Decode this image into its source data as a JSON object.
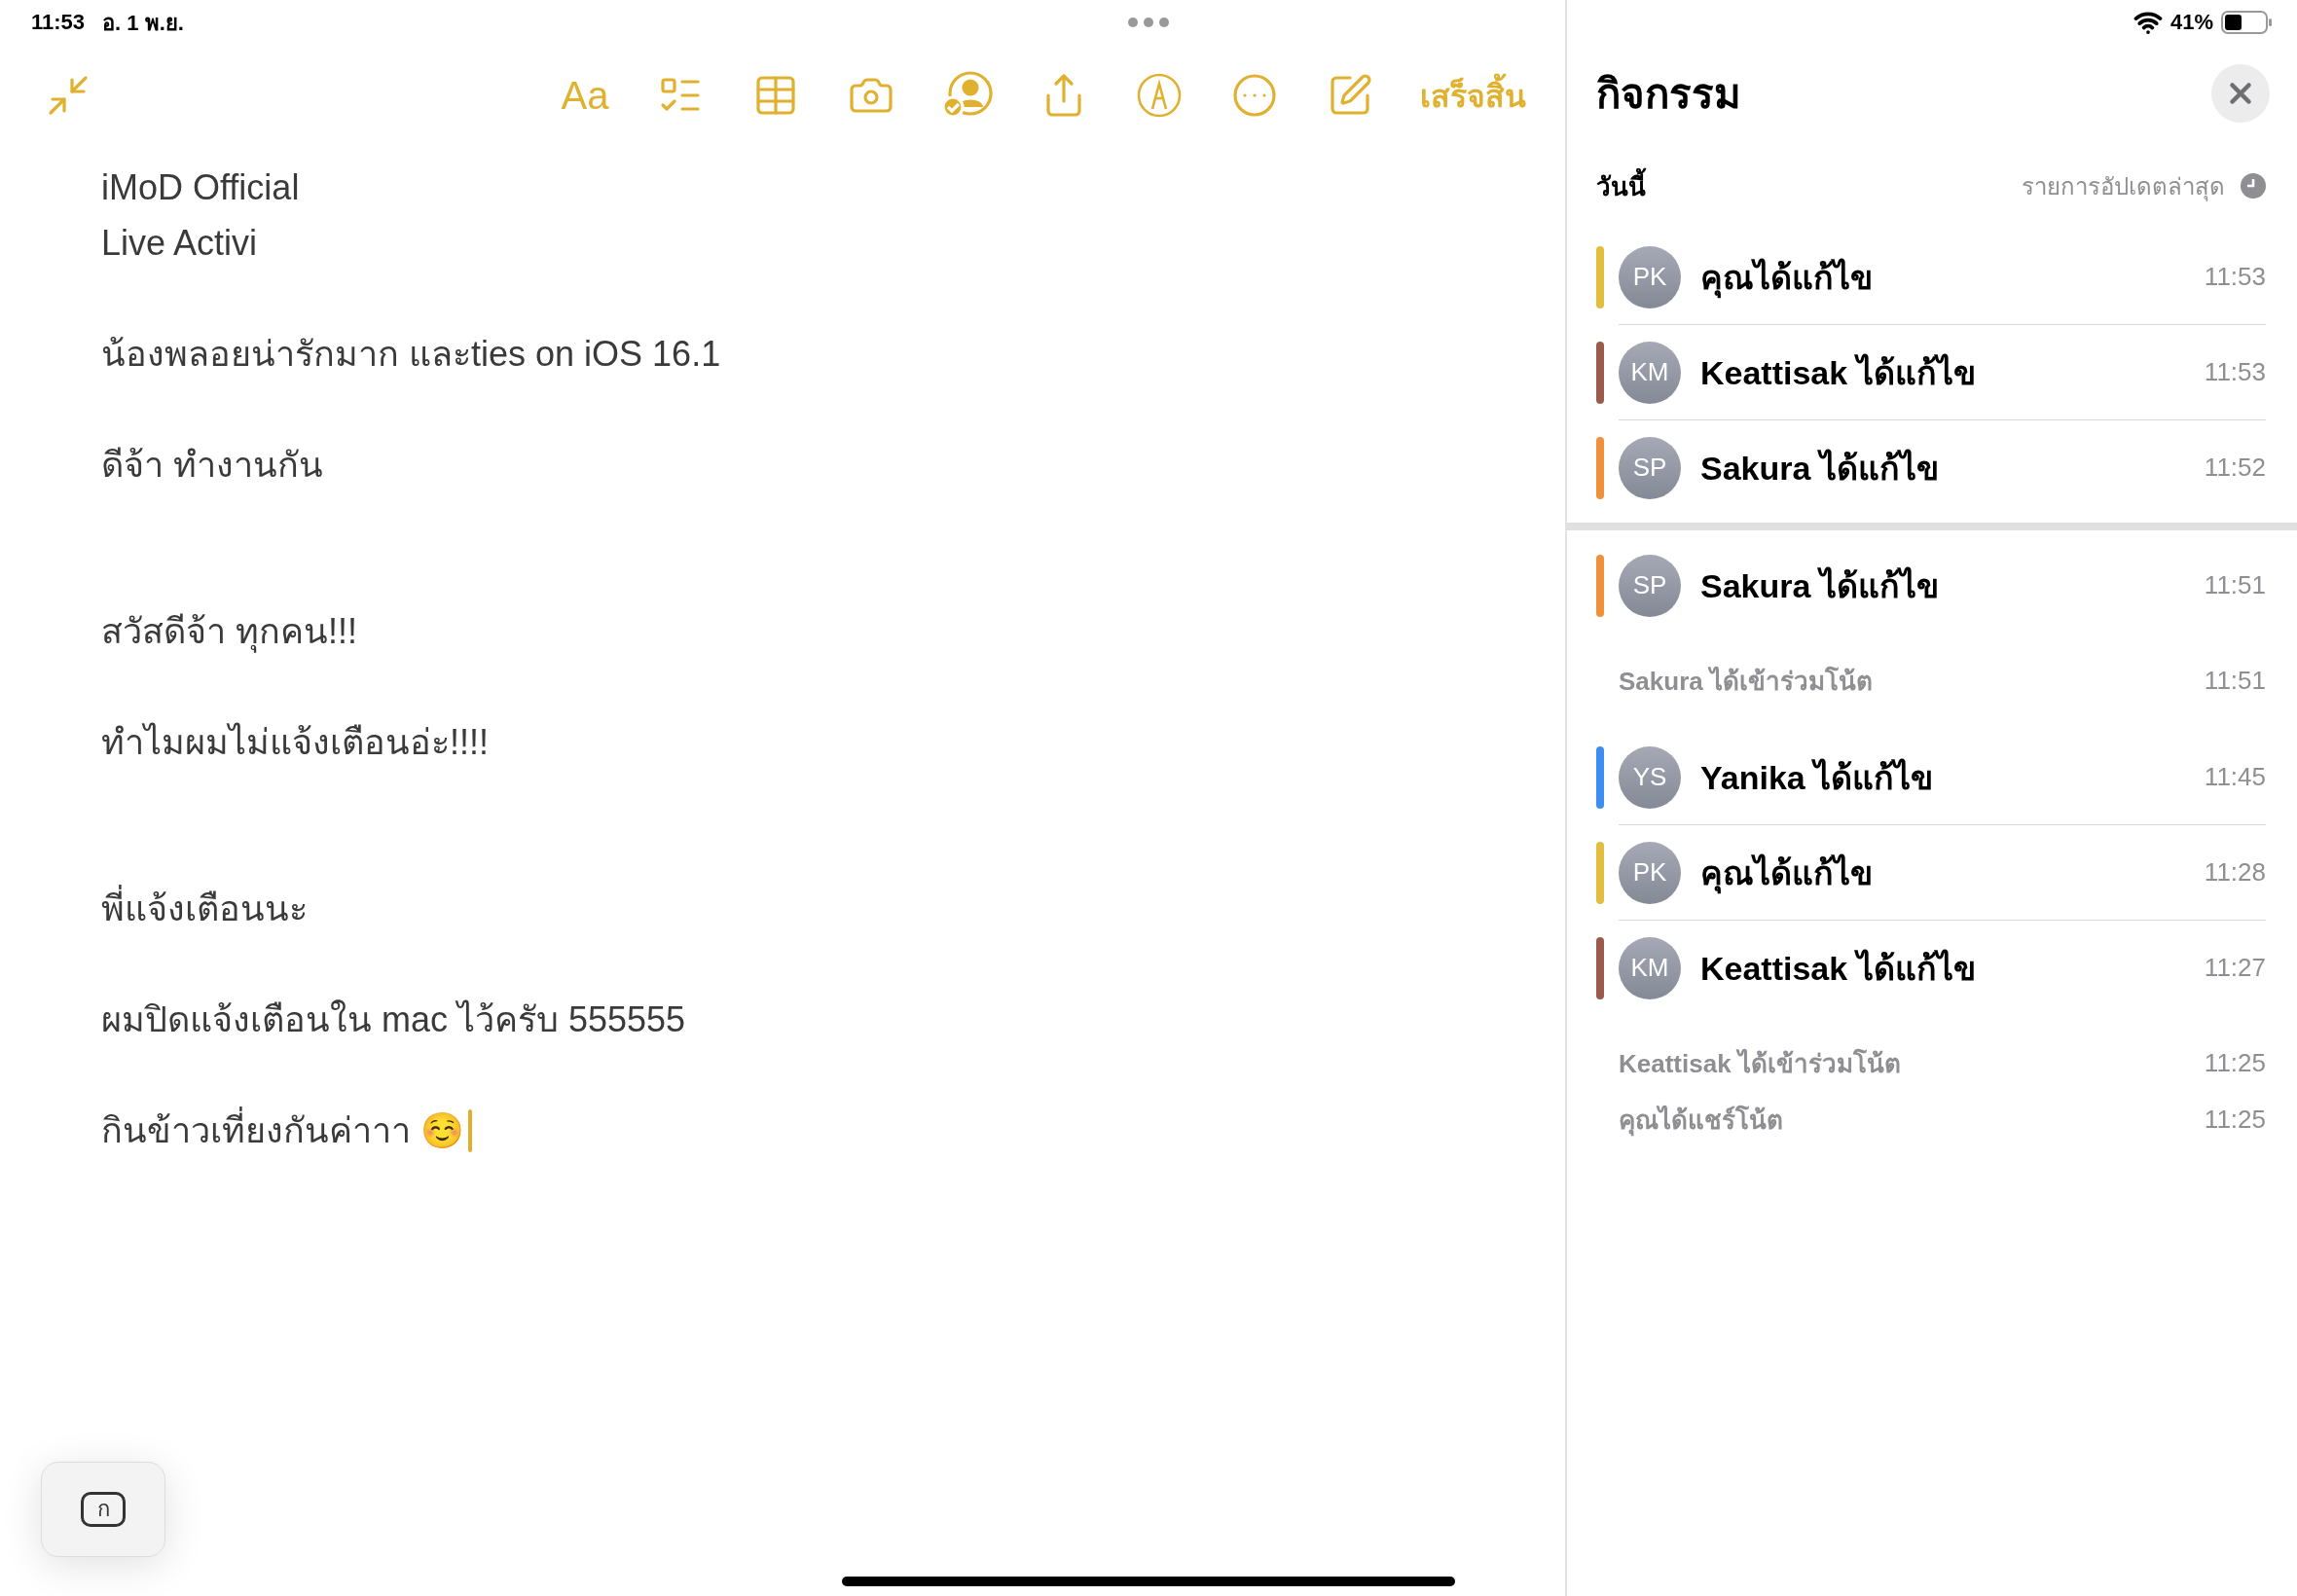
{
  "status_bar": {
    "time": "11:53",
    "date": "อ. 1 พ.ย.",
    "battery": "41%"
  },
  "toolbar": {
    "format_label": "Aa",
    "done_label": "เสร็จสิ้น"
  },
  "note": {
    "text": "iMoD Official\nLive Activi\n\nน้องพลอยน่ารักมาก และties on iOS 16.1\n\nดีจ้า ทำงานกัน\n\n\nสวัสดีจ้า ทุกคน!!!\n\nทำไมผมไม่แจ้งเตือนอ่ะ!!!!\n\n\nพี่แจ้งเตือนนะ\n\nผมปิดแจ้งเตือนใน mac ไว้ครับ 555555\n\nกินข้าวเที่ยงกันค่าาา ☺️"
  },
  "keyboard_button": {
    "label": "ก"
  },
  "activity": {
    "title": "กิจกรรม",
    "day_label": "วันนี้",
    "sort_label": "รายการอัปเดตล่าสุด",
    "sections": [
      {
        "items": [
          {
            "kind": "edit",
            "initials": "PK",
            "color": "#e3bd3c",
            "text": "คุณได้แก้ไข",
            "time": "11:53"
          },
          {
            "kind": "edit",
            "initials": "KM",
            "color": "#9c5a4d",
            "text": "Keattisak ได้แก้ไข",
            "time": "11:53"
          },
          {
            "kind": "edit",
            "initials": "SP",
            "color": "#f0913a",
            "text": "Sakura ได้แก้ไข",
            "time": "11:52"
          }
        ]
      },
      {
        "items": [
          {
            "kind": "edit",
            "initials": "SP",
            "color": "#f0913a",
            "text": "Sakura ได้แก้ไข",
            "time": "11:51"
          },
          {
            "kind": "event",
            "text": "Sakura ได้เข้าร่วมโน้ต",
            "time": "11:51"
          },
          {
            "kind": "edit",
            "initials": "YS",
            "color": "#3d8ef0",
            "text": "Yanika ได้แก้ไข",
            "time": "11:45"
          },
          {
            "kind": "edit",
            "initials": "PK",
            "color": "#e3bd3c",
            "text": "คุณได้แก้ไข",
            "time": "11:28"
          },
          {
            "kind": "edit",
            "initials": "KM",
            "color": "#9c5a4d",
            "text": "Keattisak ได้แก้ไข",
            "time": "11:27"
          },
          {
            "kind": "event",
            "text": "Keattisak ได้เข้าร่วมโน้ต",
            "time": "11:25"
          },
          {
            "kind": "event",
            "text": "คุณได้แชร์โน้ต",
            "time": "11:25"
          }
        ]
      }
    ]
  }
}
